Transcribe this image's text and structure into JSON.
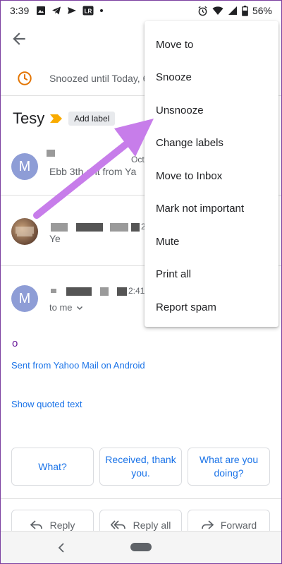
{
  "status_bar": {
    "time": "3:39",
    "battery": "56%"
  },
  "snooze_banner": {
    "text": "Snoozed until Today, 6"
  },
  "subject": {
    "title": "Tesy",
    "add_label": "Add label"
  },
  "messages": [
    {
      "avatar_letter": "M",
      "date": "Oct",
      "snippet": "Ebb 3th      ent from Ya"
    },
    {
      "avatar_letter": "",
      "date": "2",
      "snippet": "Ye"
    },
    {
      "avatar_letter": "M",
      "date": "2:41",
      "to_me": "to me"
    }
  ],
  "message_body": {
    "text": "o",
    "signature_link": "Sent from Yahoo Mail on Android",
    "show_quoted": "Show quoted text"
  },
  "smart_replies": [
    "What?",
    "Received, thank you.",
    "What are you doing?"
  ],
  "reply_actions": {
    "reply": "Reply",
    "reply_all": "Reply all",
    "forward": "Forward"
  },
  "menu": {
    "items": [
      "Move to",
      "Snooze",
      "Unsnooze",
      "Change labels",
      "Move to Inbox",
      "Mark not important",
      "Mute",
      "Print all",
      "Report spam"
    ]
  },
  "colors": {
    "accent": "#1a73e8",
    "arrow": "#c77dea",
    "snooze_clock": "#e37400",
    "label_tag": "#f9ab00",
    "avatar": "#8e9dd6"
  },
  "icons": {
    "back": "back-arrow-icon",
    "clock": "clock-icon",
    "tag": "label-tag-icon"
  }
}
